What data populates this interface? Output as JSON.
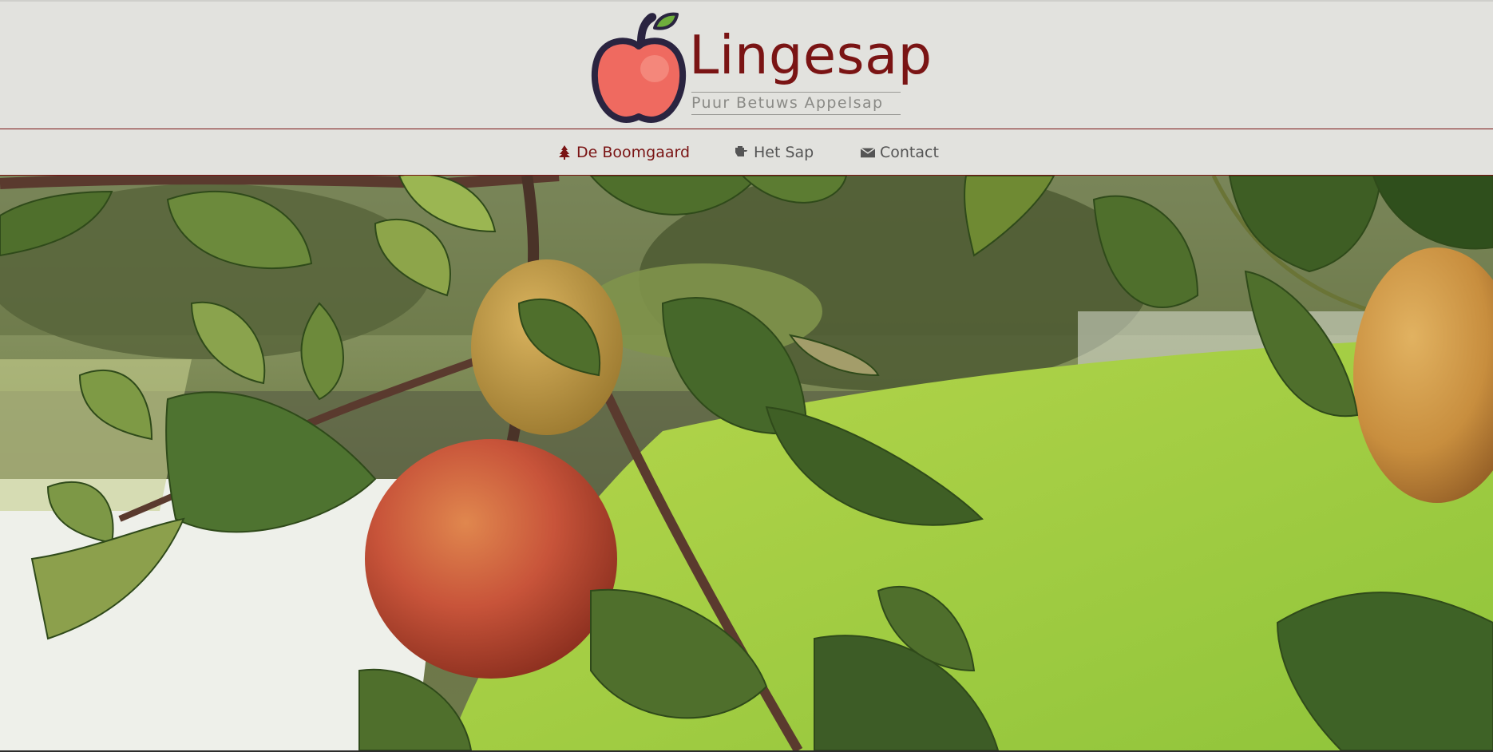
{
  "brand": {
    "name": "Lingesap",
    "tagline": "Puur Betuws Appelsap",
    "logo_icon": "apple-icon",
    "colors": {
      "primary": "#7a1414",
      "apple": "#ef6a60",
      "leaf": "#6fae3c",
      "outline": "#2a2440"
    }
  },
  "nav": {
    "items": [
      {
        "label": "De Boomgaard",
        "icon": "tree-icon",
        "active": true
      },
      {
        "label": "Het Sap",
        "icon": "juice-icon",
        "active": false
      },
      {
        "label": "Contact",
        "icon": "envelope-icon",
        "active": false
      }
    ]
  },
  "hero": {
    "image": "apple-branch-photo"
  }
}
